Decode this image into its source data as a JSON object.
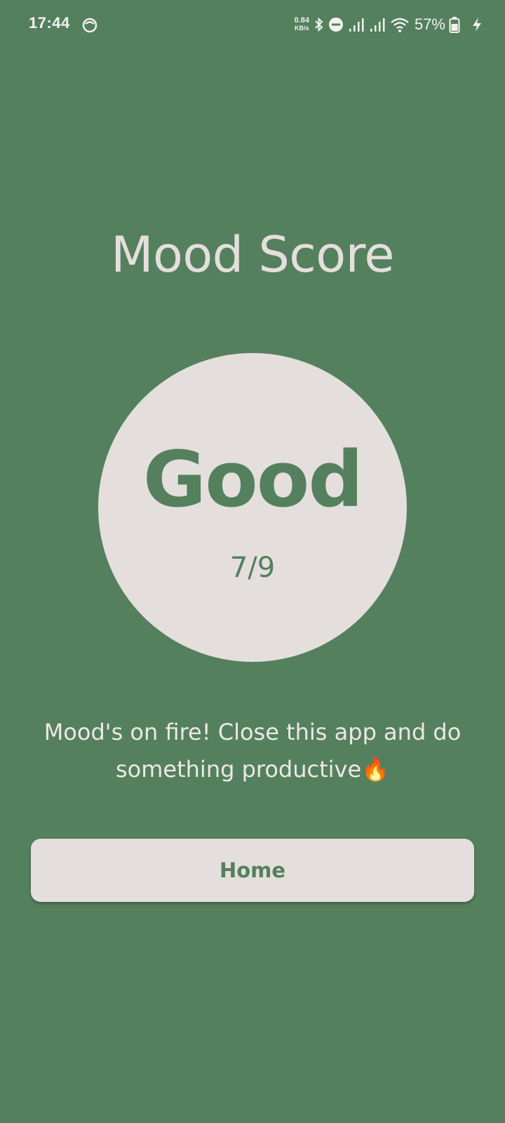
{
  "status_bar": {
    "time": "17:44",
    "net_speed_value": "0.84",
    "net_speed_unit": "KB/s",
    "battery_percent": "57%",
    "icons": [
      "app-notification-icon",
      "bluetooth-icon",
      "do-not-disturb-icon",
      "signal-icon",
      "signal-icon",
      "wifi-icon",
      "battery-icon",
      "charging-icon"
    ]
  },
  "main": {
    "title": "Mood Score",
    "score_label": "Good",
    "score_fraction": "7/9",
    "message": "Mood's on fire! Close this app and do something productive🔥",
    "home_button_label": "Home"
  },
  "colors": {
    "background": "#54805e",
    "surface": "#e4dfdc",
    "accent_text": "#54805e"
  }
}
